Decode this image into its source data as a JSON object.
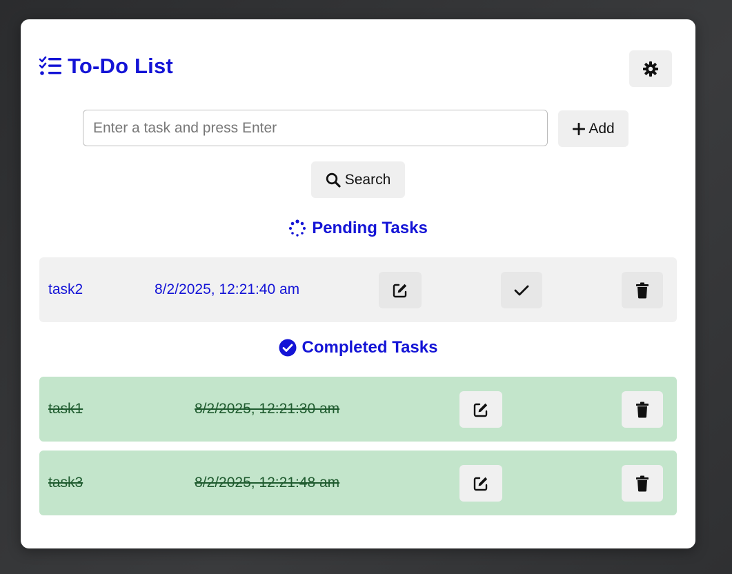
{
  "app": {
    "title": "To-Do List",
    "accent_color": "#1414d6"
  },
  "theme_toggle": {
    "icon": "gear-icon"
  },
  "input": {
    "placeholder": "Enter a task and press Enter",
    "value": ""
  },
  "buttons": {
    "add_label": "Add",
    "search_label": "Search"
  },
  "sections": {
    "pending_title": "Pending Tasks",
    "completed_title": "Completed Tasks"
  },
  "pending_tasks": [
    {
      "name": "task2",
      "timestamp": "8/2/2025, 12:21:40 am"
    }
  ],
  "completed_tasks": [
    {
      "name": "task1",
      "timestamp": "8/2/2025, 12:21:30 am"
    },
    {
      "name": "task3",
      "timestamp": "8/2/2025, 12:21:48 am"
    }
  ],
  "colors": {
    "pending_row_bg": "#f1f1f1",
    "completed_row_bg": "#c3e5cb",
    "completed_text": "#1f5b2f"
  }
}
